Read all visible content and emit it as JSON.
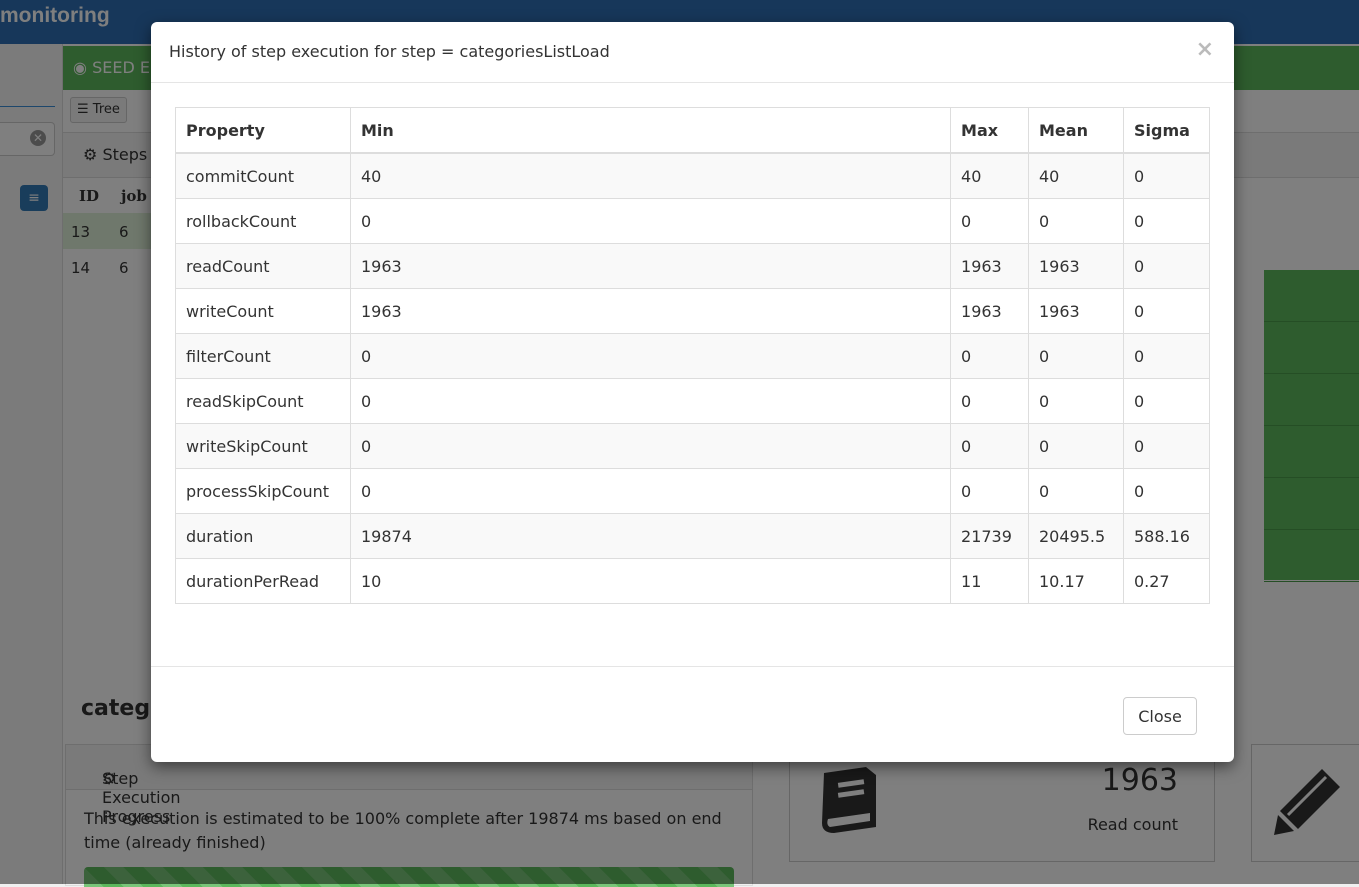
{
  "app": {
    "brand": "monitoring"
  },
  "background": {
    "panel_title": "SEED E",
    "tree_button": "Tree",
    "steps_title": "Steps",
    "table_headers": [
      "ID",
      "job"
    ],
    "rows": [
      [
        "13",
        "6"
      ],
      [
        "14",
        "6"
      ]
    ],
    "section_title": "catego",
    "progress": {
      "title": "Step Execution Progress",
      "text": "This execution is estimated to be 100% complete after 19874 ms based on end time (already finished)",
      "percent": 100
    },
    "stat": {
      "value": "1963",
      "label": "Read count"
    }
  },
  "modal": {
    "title": "History of step execution for step = categoriesListLoad",
    "close_icon": "×",
    "columns": [
      "Property",
      "Min",
      "Max",
      "Mean",
      "Sigma"
    ],
    "rows": [
      [
        "commitCount",
        "40",
        "40",
        "40",
        "0"
      ],
      [
        "rollbackCount",
        "0",
        "0",
        "0",
        "0"
      ],
      [
        "readCount",
        "1963",
        "1963",
        "1963",
        "0"
      ],
      [
        "writeCount",
        "1963",
        "1963",
        "1963",
        "0"
      ],
      [
        "filterCount",
        "0",
        "0",
        "0",
        "0"
      ],
      [
        "readSkipCount",
        "0",
        "0",
        "0",
        "0"
      ],
      [
        "writeSkipCount",
        "0",
        "0",
        "0",
        "0"
      ],
      [
        "processSkipCount",
        "0",
        "0",
        "0",
        "0"
      ],
      [
        "duration",
        "19874",
        "21739",
        "20495.5",
        "588.16"
      ],
      [
        "durationPerRead",
        "10",
        "11",
        "10.17",
        "0.27"
      ]
    ],
    "close_button": "Close"
  },
  "colors": {
    "topbar": "#2f6fb5",
    "success": "#5cb85c",
    "primary": "#337ab7"
  },
  "icons": {
    "panel": "dashboard-icon",
    "tree": "list-icon",
    "steps": "cogs-icon",
    "stat": "book-icon",
    "edit": "pencil-icon"
  }
}
